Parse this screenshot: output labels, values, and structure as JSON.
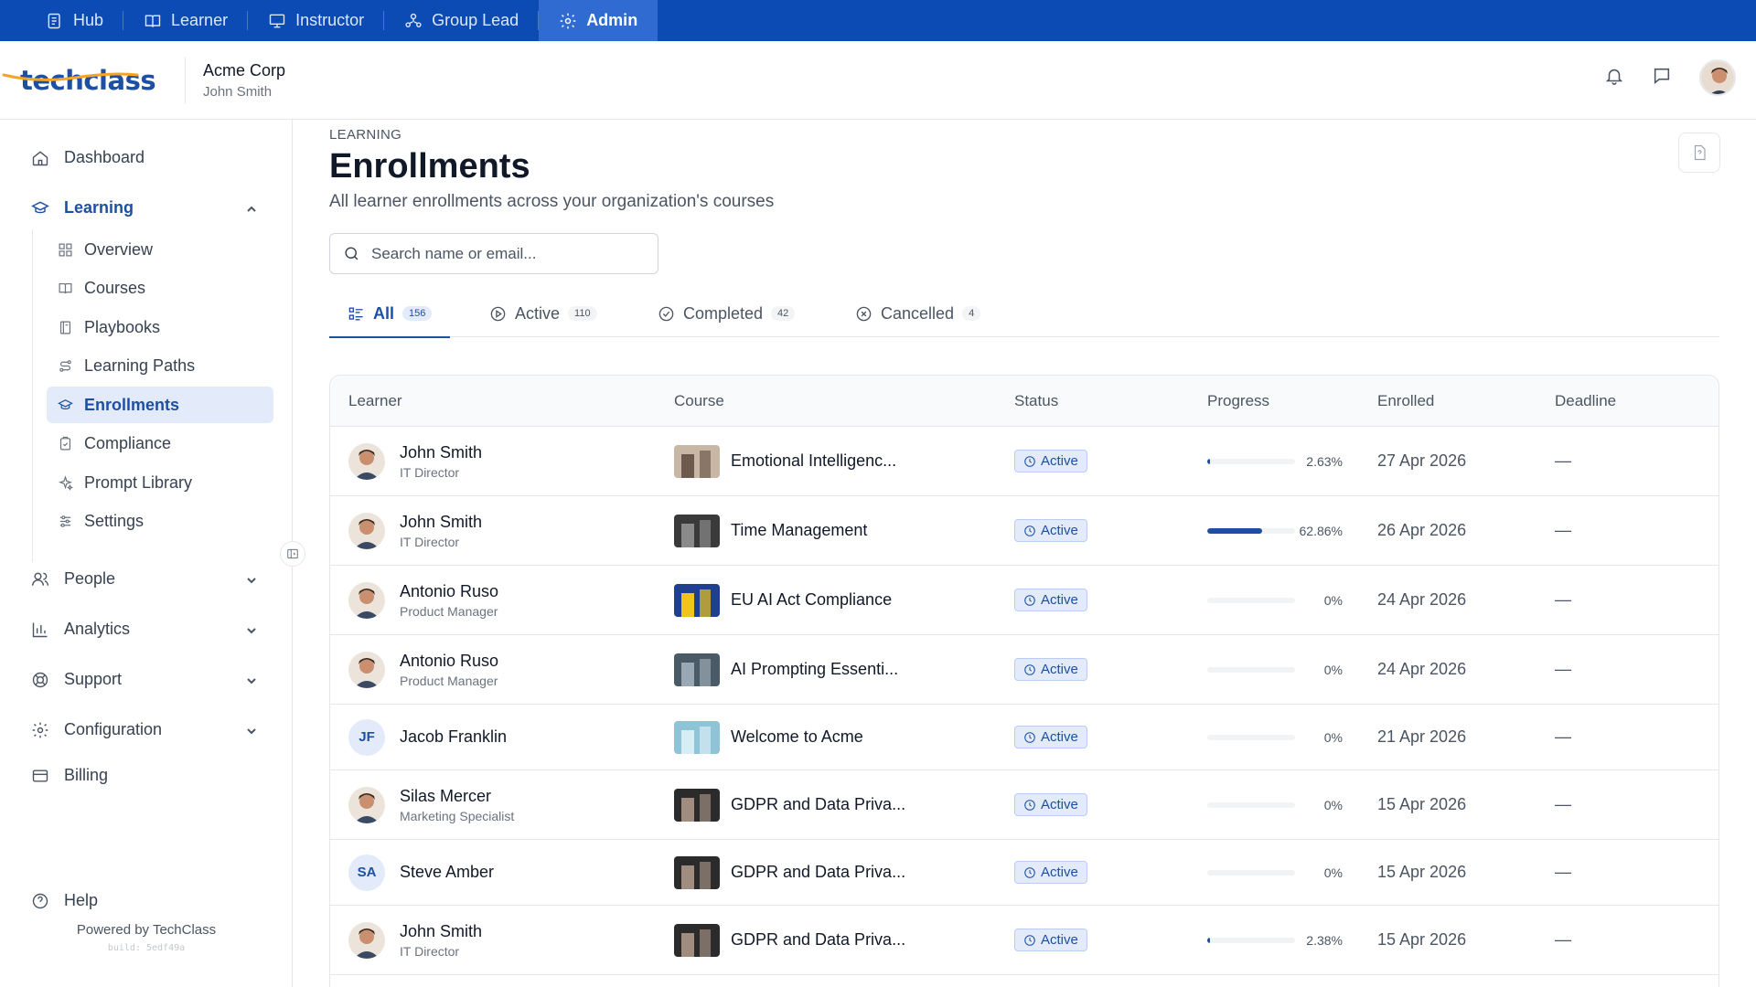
{
  "topnav": {
    "tabs": [
      {
        "label": "Hub",
        "icon": "hub-icon"
      },
      {
        "label": "Learner",
        "icon": "book-open-icon"
      },
      {
        "label": "Instructor",
        "icon": "presentation-icon"
      },
      {
        "label": "Group Lead",
        "icon": "group-icon"
      },
      {
        "label": "Admin",
        "icon": "gear-icon",
        "active": true
      }
    ]
  },
  "header": {
    "logo_text": "techclass",
    "org_name": "Acme Corp",
    "user_name": "John Smith"
  },
  "sidebar": {
    "dashboard": "Dashboard",
    "learning": "Learning",
    "learning_items": [
      "Overview",
      "Courses",
      "Playbooks",
      "Learning Paths",
      "Enrollments",
      "Compliance",
      "Prompt Library",
      "Settings"
    ],
    "active_item": "Enrollments",
    "people": "People",
    "analytics": "Analytics",
    "support": "Support",
    "configuration": "Configuration",
    "billing": "Billing",
    "help": "Help",
    "powered_by": "Powered by TechClass",
    "build": "build: 5edf49a"
  },
  "page": {
    "eyebrow": "LEARNING",
    "title": "Enrollments",
    "subtitle": "All learner enrollments across your organization's courses",
    "search_placeholder": "Search name or email..."
  },
  "filters": [
    {
      "label": "All",
      "count": "156",
      "active": true
    },
    {
      "label": "Active",
      "count": "110"
    },
    {
      "label": "Completed",
      "count": "42"
    },
    {
      "label": "Cancelled",
      "count": "4"
    }
  ],
  "table": {
    "columns": [
      "Learner",
      "Course",
      "Status",
      "Progress",
      "Enrolled",
      "Deadline"
    ],
    "rows": [
      {
        "name": "John Smith",
        "role": "IT Director",
        "avatar": "photo",
        "course": "Emotional Intelligenc...",
        "status": "Active",
        "progress": 2.63,
        "progress_label": "2.63%",
        "enrolled": "27 Apr 2026",
        "deadline": "—"
      },
      {
        "name": "John Smith",
        "role": "IT Director",
        "avatar": "photo",
        "course": "Time Management",
        "status": "Active",
        "progress": 62.86,
        "progress_label": "62.86%",
        "enrolled": "26 Apr 2026",
        "deadline": "—"
      },
      {
        "name": "Antonio Ruso",
        "role": "Product Manager",
        "avatar": "photo",
        "course": "EU AI Act Compliance",
        "status": "Active",
        "progress": 0,
        "progress_label": "0%",
        "enrolled": "24 Apr 2026",
        "deadline": "—"
      },
      {
        "name": "Antonio Ruso",
        "role": "Product Manager",
        "avatar": "photo",
        "course": "AI Prompting Essenti...",
        "status": "Active",
        "progress": 0,
        "progress_label": "0%",
        "enrolled": "24 Apr 2026",
        "deadline": "—"
      },
      {
        "name": "Jacob Franklin",
        "role": "",
        "avatar": "JF",
        "course": "Welcome to Acme",
        "status": "Active",
        "progress": 0,
        "progress_label": "0%",
        "enrolled": "21 Apr 2026",
        "deadline": "—"
      },
      {
        "name": "Silas Mercer",
        "role": "Marketing Specialist",
        "avatar": "photo",
        "course": "GDPR and Data Priva...",
        "status": "Active",
        "progress": 0,
        "progress_label": "0%",
        "enrolled": "15 Apr 2026",
        "deadline": "—"
      },
      {
        "name": "Steve Amber",
        "role": "",
        "avatar": "SA",
        "course": "GDPR and Data Priva...",
        "status": "Active",
        "progress": 0,
        "progress_label": "0%",
        "enrolled": "15 Apr 2026",
        "deadline": "—"
      },
      {
        "name": "John Smith",
        "role": "IT Director",
        "avatar": "photo",
        "course": "GDPR and Data Priva...",
        "status": "Active",
        "progress": 2.38,
        "progress_label": "2.38%",
        "enrolled": "15 Apr 2026",
        "deadline": "—"
      }
    ]
  },
  "colors": {
    "brand": "#0b4bb3",
    "accent": "#1d4fa3",
    "active_badge_bg": "#e3ebfb"
  }
}
